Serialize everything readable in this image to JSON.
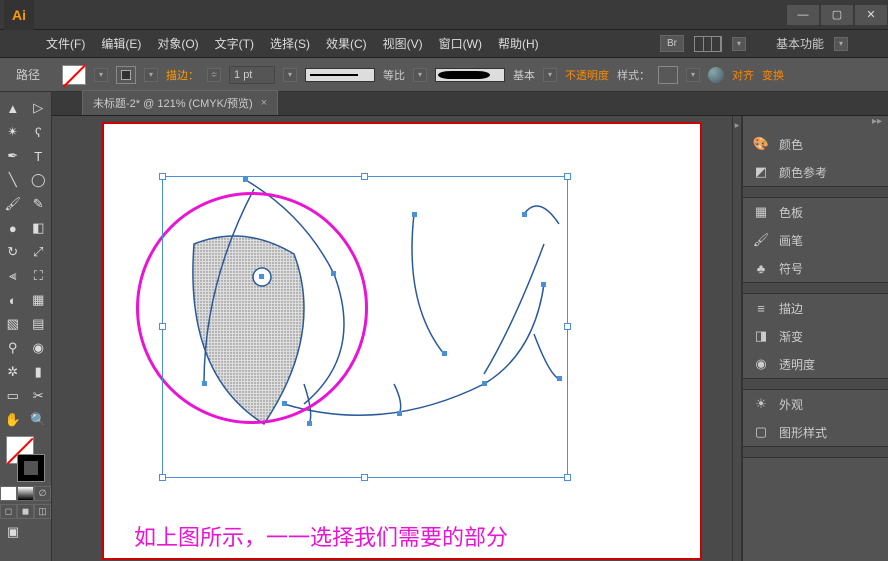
{
  "app": {
    "icon_text": "Ai"
  },
  "menu": {
    "file": "文件(F)",
    "edit": "编辑(E)",
    "object": "对象(O)",
    "type": "文字(T)",
    "select": "选择(S)",
    "effect": "效果(C)",
    "view": "视图(V)",
    "window": "窗口(W)",
    "help": "帮助(H)",
    "bridge_badge": "Br",
    "workspace": "基本功能"
  },
  "control": {
    "path_label": "路径",
    "stroke_label": "描边：",
    "stroke_value": "1 pt",
    "uniform_label": "等比",
    "profile_label": "基本",
    "opacity_label": "不透明度",
    "style_label": "样式：",
    "align_label": "对齐",
    "transform_label": "变换"
  },
  "tab": {
    "title": "未标题-2* @ 121% (CMYK/预览)"
  },
  "canvas": {
    "caption": "如上图所示，一一选择我们需要的部分"
  },
  "panels": {
    "color": "颜色",
    "color_guide": "颜色参考",
    "swatches": "色板",
    "brushes": "画笔",
    "symbols": "符号",
    "stroke": "描边",
    "gradient": "渐变",
    "transparency": "透明度",
    "appearance": "外观",
    "graphic_styles": "图形样式"
  }
}
